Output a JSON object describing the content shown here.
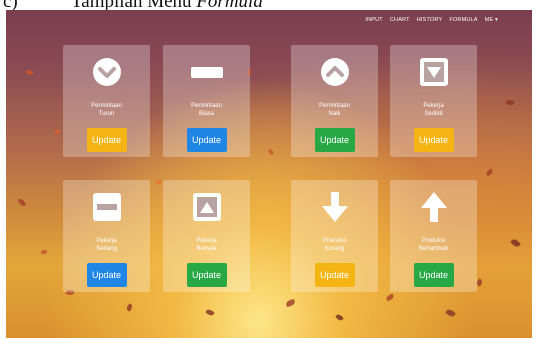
{
  "caption": {
    "number": "c)",
    "prefix": "Tampilan Menu",
    "italic": "Formula"
  },
  "nav": {
    "items": [
      "INPUT",
      "CHART",
      "HISTORY",
      "FORMULA",
      "ME ▾"
    ]
  },
  "colors": {
    "yellow": "#f4b514",
    "blue": "#1f86e6",
    "green": "#28a745"
  },
  "cards": [
    {
      "label": "Permintaan\nTurun",
      "icon": "chevron-down-circle-icon",
      "button": "Update",
      "color": "yellow"
    },
    {
      "label": "Permintaan\nBiasa",
      "icon": "minus-bar-icon",
      "button": "Update",
      "color": "blue"
    },
    {
      "label": "Permintaan\nNaik",
      "icon": "chevron-up-circle-icon",
      "button": "Update",
      "color": "green"
    },
    {
      "label": "Pekerja\nSedikit",
      "icon": "triangle-down-square-icon",
      "button": "Update",
      "color": "yellow"
    },
    {
      "label": "Pekerja\nSedang",
      "icon": "minus-square-icon",
      "button": "Update",
      "color": "blue"
    },
    {
      "label": "Pekerja\nBanyak",
      "icon": "triangle-up-square-icon",
      "button": "Update",
      "color": "green"
    },
    {
      "label": "Produksi\nKurang",
      "icon": "arrow-down-icon",
      "button": "Update",
      "color": "yellow"
    },
    {
      "label": "Produksi\nBertambah",
      "icon": "arrow-up-icon",
      "button": "Update",
      "color": "green"
    }
  ]
}
